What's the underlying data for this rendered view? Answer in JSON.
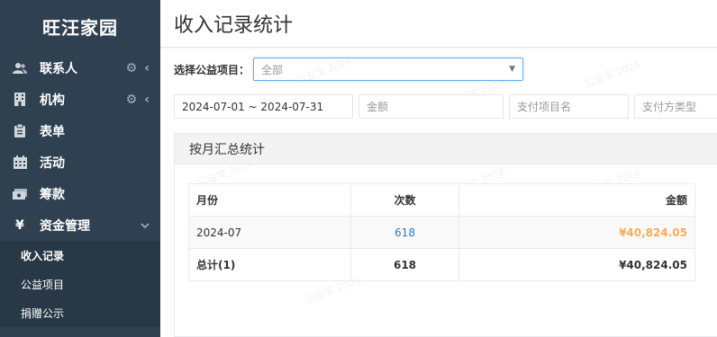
{
  "sidebar": {
    "brand": "旺汪家园",
    "items": [
      {
        "label": "联系人",
        "icon": "users-icon",
        "glyph": "👥",
        "has_tools": true
      },
      {
        "label": "机构",
        "icon": "building-icon",
        "glyph": "🏢",
        "has_tools": true
      },
      {
        "label": "表单",
        "icon": "clipboard-icon",
        "glyph": "📋",
        "has_tools": false
      },
      {
        "label": "活动",
        "icon": "calendar-icon",
        "glyph": "▦",
        "has_tools": false
      },
      {
        "label": "筹款",
        "icon": "money-icon",
        "glyph": "💴",
        "has_tools": false
      },
      {
        "label": "资金管理",
        "icon": "yen-icon",
        "glyph": "¥",
        "has_tools": false,
        "expanded": true
      }
    ],
    "sub_items": [
      {
        "label": "收入记录",
        "active": true
      },
      {
        "label": "公益项目",
        "active": false
      },
      {
        "label": "捐赠公示",
        "active": false
      }
    ]
  },
  "page": {
    "title": "收入记录统计"
  },
  "filters": {
    "project_label": "选择公益项目：",
    "project_value": "全部",
    "date_range": "2024-07-01 ~ 2024-07-31",
    "amount_placeholder": "金额",
    "pay_item_placeholder": "支付项目名",
    "pay_type_placeholder": "支付方类型"
  },
  "panel": {
    "title": "按月汇总统计",
    "columns": [
      "月份",
      "次数",
      "金额"
    ],
    "rows": [
      {
        "month": "2024-07",
        "count": "618",
        "amount": "¥40,824.05"
      }
    ],
    "total": {
      "label": "总计(1)",
      "count": "618",
      "amount": "¥40,824.05"
    }
  },
  "colors": {
    "sidebar_bg": "#2f4050",
    "accent_blue": "#337ab7",
    "amount_yellow": "#f8ac59"
  }
}
